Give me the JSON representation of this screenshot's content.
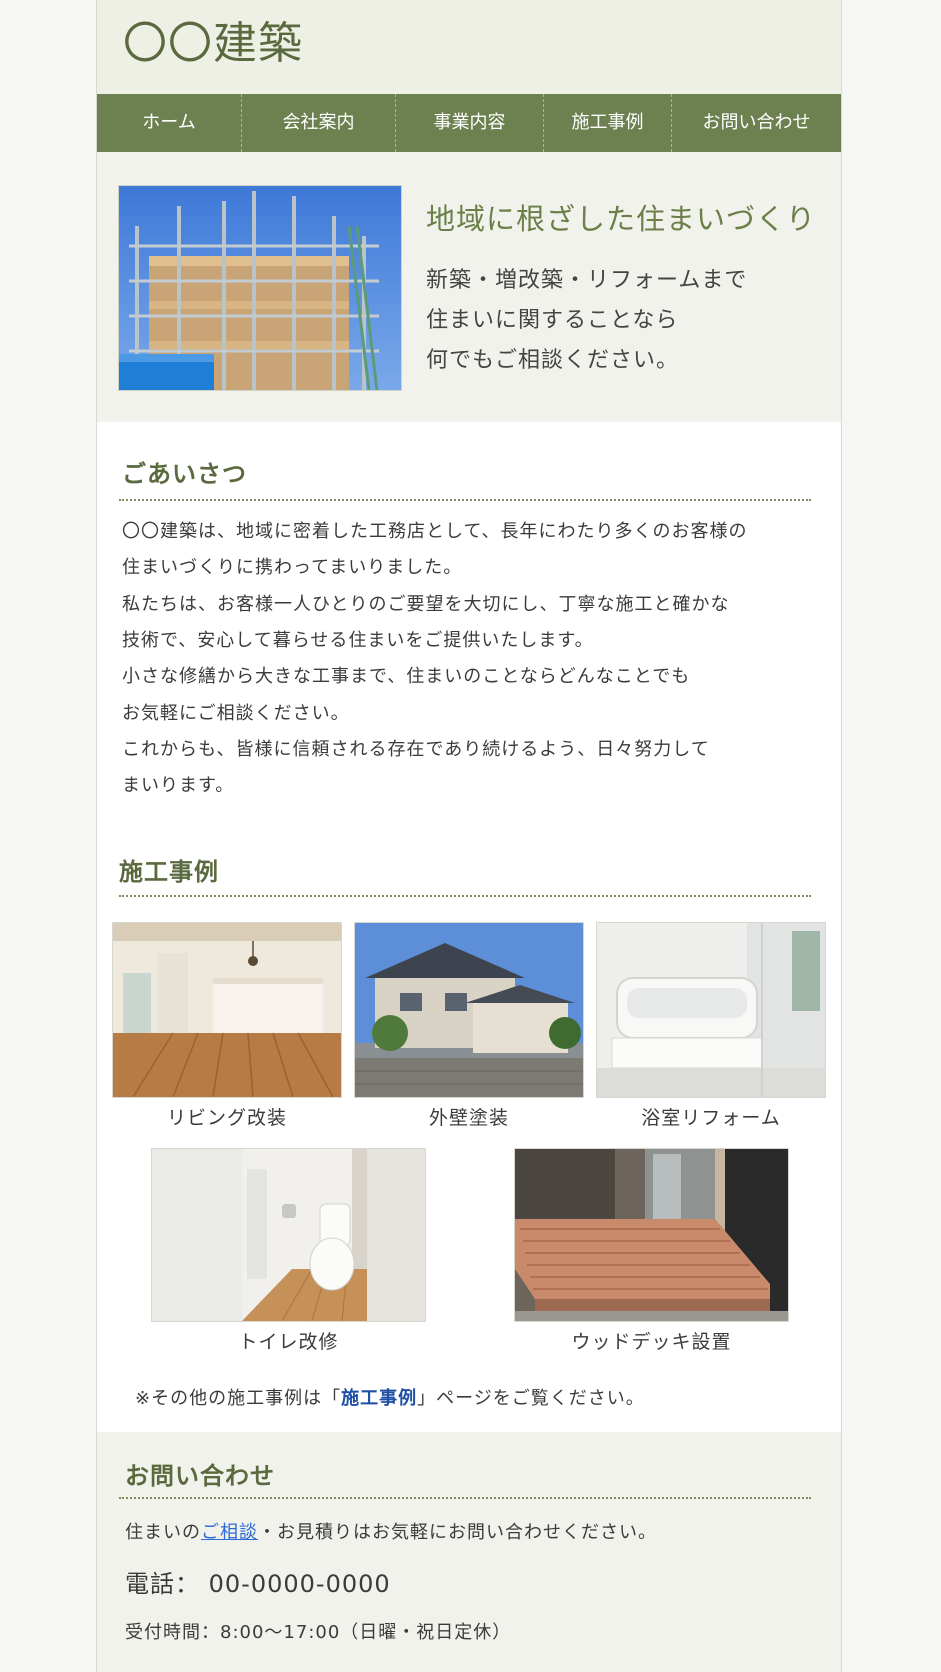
{
  "site": {
    "title": "〇〇建築"
  },
  "nav": {
    "items": [
      "ホーム",
      "会社案内",
      "事業内容",
      "施工事例",
      "お問い合わせ"
    ]
  },
  "hero": {
    "title": "地域に根ざした住まいづくり",
    "lines": [
      "新築・増改築・リフォームまで",
      "住まいに関することなら",
      "何でもご相談ください。"
    ]
  },
  "greeting": {
    "title": "ごあいさつ",
    "lines": [
      "〇〇建築は、地域に密着した工務店として、長年にわたり多くのお客様の",
      "住まいづくりに携わってまいりました。",
      "私たちは、お客様一人ひとりのご要望を大切にし、丁寧な施工と確かな",
      "技術で、安心して暮らせる住まいをご提供いたします。",
      "小さな修繕から大きな工事まで、住まいのことならどんなことでも",
      "お気軽にご相談ください。",
      "これからも、皆様に信頼される存在であり続けるよう、日々努力して",
      "まいります。"
    ]
  },
  "cases": {
    "title": "施工事例",
    "items": [
      "リビング改装",
      "外壁塗装",
      "浴室リフォーム",
      "トイレ改修",
      "ウッドデッキ設置"
    ],
    "note_prefix": "※その他の施工事例は「",
    "note_link": "施工事例",
    "note_suffix": "」ページをご覧ください。"
  },
  "contact": {
    "title": "お問い合わせ",
    "text_prefix": "住まいの",
    "text_link": "ご相談",
    "text_suffix": "・お見積りはお気軽にお問い合わせください。",
    "phone": "電話： 00-0000-0000",
    "hours": "受付時間：8:00〜17:00（日曜・祝日定休）"
  }
}
